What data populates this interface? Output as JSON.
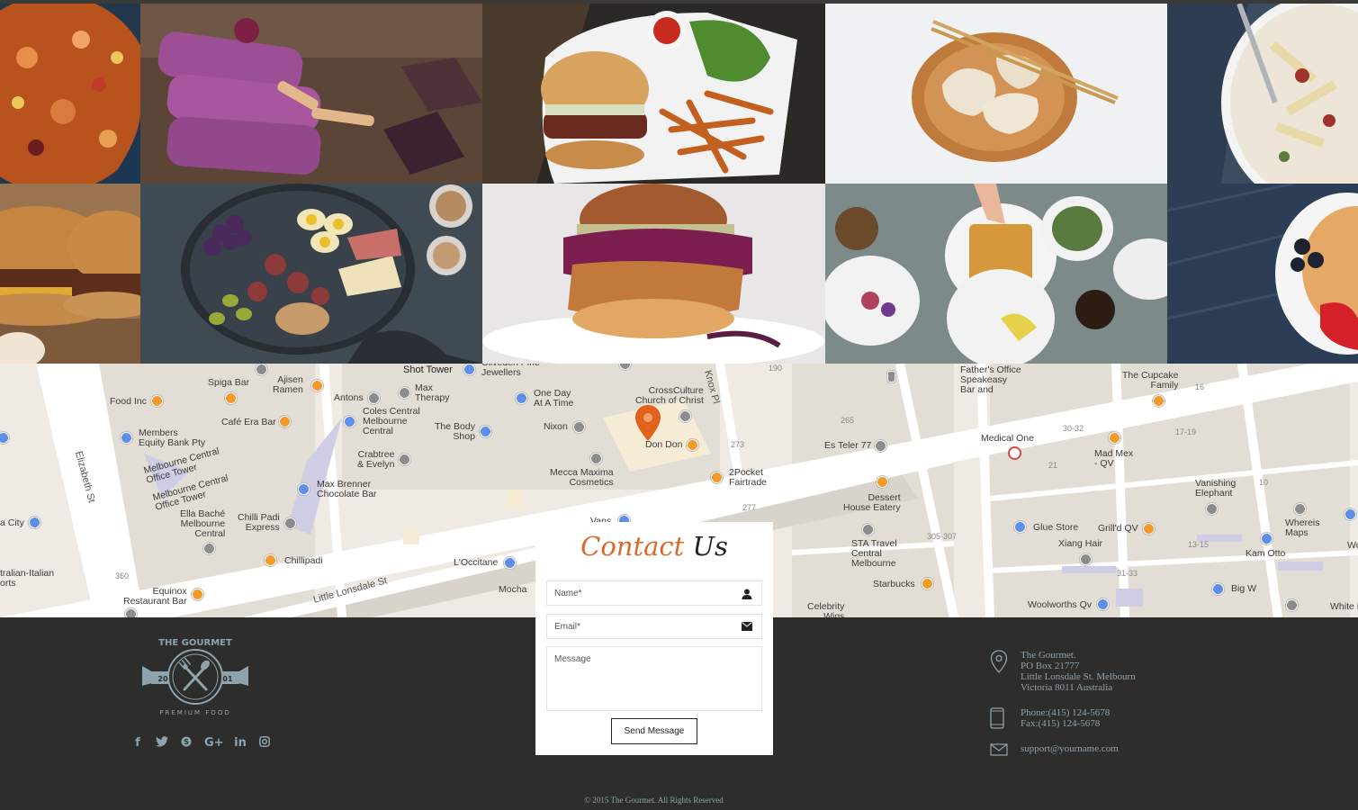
{
  "gallery": {
    "tiles": [
      {
        "subject": "seafood paella"
      },
      {
        "subject": "purple ice pops"
      },
      {
        "subject": "burger with fries"
      },
      {
        "subject": "dumplings with chopsticks"
      },
      {
        "subject": "pasta with fork"
      },
      {
        "subject": "burger close-up"
      },
      {
        "subject": "figs and eggs platter"
      },
      {
        "subject": "fried chicken sandwich"
      },
      {
        "subject": "waffles breakfast table"
      },
      {
        "subject": "pancakes with berries"
      }
    ]
  },
  "map": {
    "pois": [
      {
        "label": "Shot Tower"
      },
      {
        "label": "Cliveden Pine\nJewellers"
      },
      {
        "label": "Ajisen\nRamen"
      },
      {
        "label": "Spiga Bar"
      },
      {
        "label": "Food Inc"
      },
      {
        "label": "Café Era Bar"
      },
      {
        "label": "Antons"
      },
      {
        "label": "Max\nTherapy"
      },
      {
        "label": "Coles Central\nMelbourne\nCentral"
      },
      {
        "label": "One Day\nAt A Time"
      },
      {
        "label": "CrossCulture\nChurch of Christ"
      },
      {
        "label": "Members\nEquity Bank Pty"
      },
      {
        "label": "The Body\nShop"
      },
      {
        "label": "Nixon"
      },
      {
        "label": "Don Don"
      },
      {
        "label": "Melbourne Central\nOffice Tower"
      },
      {
        "label": "Melbourne Central\nOffice Tower"
      },
      {
        "label": "Crabtree\n& Evelyn"
      },
      {
        "label": "Max Brenner\nChocolate Bar"
      },
      {
        "label": "Mecca Maxima\nCosmetics"
      },
      {
        "label": "2Pocket\nFairtrade"
      },
      {
        "label": "Ella Baché\nMelbourne\nCentral"
      },
      {
        "label": "Chilli Padi\nExpress"
      },
      {
        "label": "Chillipadi"
      },
      {
        "label": "L'Occitane"
      },
      {
        "label": "Mocha"
      },
      {
        "label": "Vans"
      },
      {
        "label": "Equinox\nRestaurant Bar"
      },
      {
        "label": "Father's Office\nSpeakeasy\nBar and"
      },
      {
        "label": "The Cupcake\nFamily"
      },
      {
        "label": "Es Teler 77"
      },
      {
        "label": "Medical One"
      },
      {
        "label": "Mad Mex\n- QV"
      },
      {
        "label": "Dessert\nHouse Eatery"
      },
      {
        "label": "Vanishing\nElephant"
      },
      {
        "label": "Glue Store"
      },
      {
        "label": "Grill'd QV"
      },
      {
        "label": "Whereis\nMaps"
      },
      {
        "label": "Xiang Hair"
      },
      {
        "label": "Kam Otto"
      },
      {
        "label": "STA Travel\nCentral\nMelbourne"
      },
      {
        "label": "Starbucks"
      },
      {
        "label": "Big W"
      },
      {
        "label": "Woolworths Qv"
      },
      {
        "label": "Celebrity\nWigs"
      },
      {
        "label": "White H"
      },
      {
        "label": "Wo"
      },
      {
        "label": "a City"
      },
      {
        "label": "tralian-Italian\norts"
      }
    ],
    "streets": [
      "Elizabeth St",
      "Little Lonsdale St",
      "Knox Pl"
    ],
    "numbers": [
      "190",
      "265",
      "273",
      "277",
      "305-307",
      "360",
      "16",
      "17-19",
      "30-32",
      "21",
      "10",
      "13-15",
      "31-33"
    ],
    "marker_color": "#e0621c"
  },
  "contact_form": {
    "title_part1": "Contact",
    "title_part2": "Us",
    "name_placeholder": "Name*",
    "email_placeholder": "Email*",
    "message_placeholder": "Message",
    "submit_label": "Send Message"
  },
  "footer": {
    "logo": {
      "top_text": "THE GOURMET",
      "year_left": "20",
      "year_right": "01",
      "bottom_text": "PREMIUM FOOD"
    },
    "social": [
      {
        "icon": "facebook-icon",
        "glyph": "f"
      },
      {
        "icon": "twitter-icon",
        "glyph": "t"
      },
      {
        "icon": "skype-icon",
        "glyph": "s"
      },
      {
        "icon": "google-plus-icon",
        "glyph": "G+"
      },
      {
        "icon": "linkedin-icon",
        "glyph": "in"
      },
      {
        "icon": "instagram-icon",
        "glyph": "◎"
      }
    ],
    "address_lines": [
      "The Gourmet.",
      "PO Box 21777",
      "Little Lonsdale St. Melbourn",
      "Victoria 8011 Australia"
    ],
    "phone": "Phone:(415) 124-5678",
    "fax": "Fax:(415) 124-5678",
    "email": "support@yourname.com",
    "copyright": "© 2015 The Gourmet. All Rights Reserved"
  },
  "colors": {
    "accent": "#d8692a",
    "footer_bg": "#2d2d2b",
    "footer_text": "#8fa3ad",
    "map_bg": "#efebe4"
  }
}
